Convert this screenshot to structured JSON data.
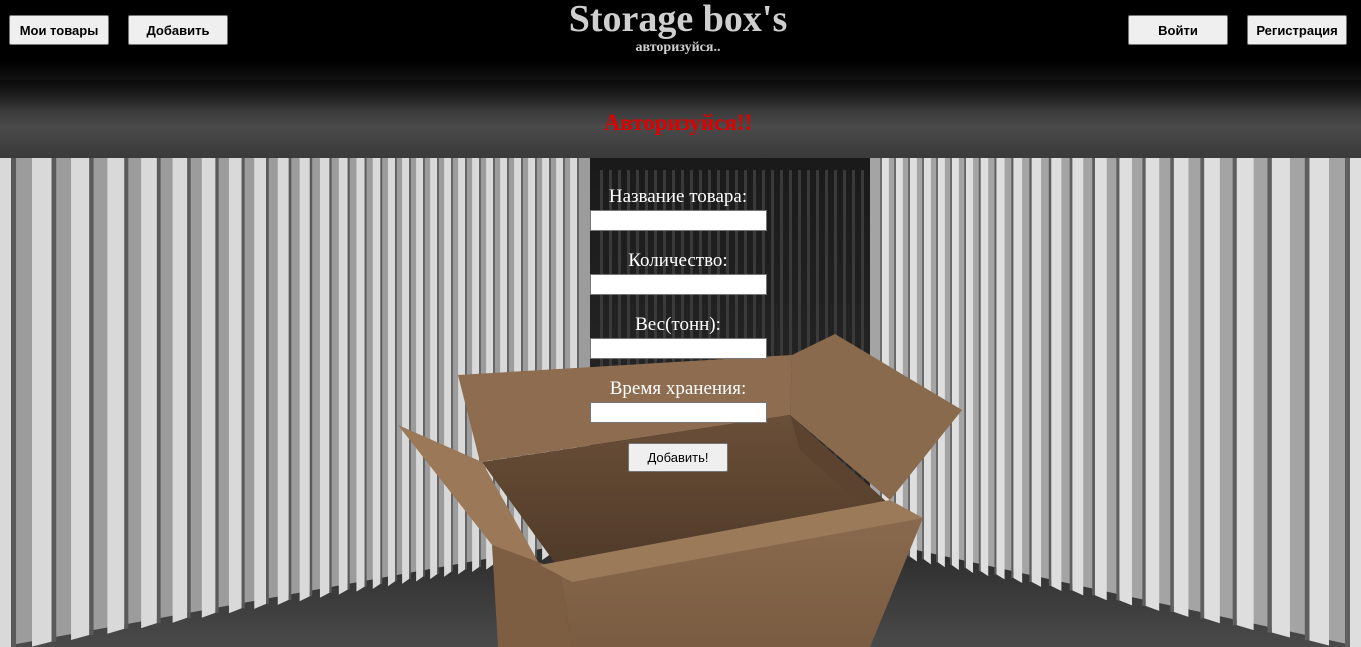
{
  "header": {
    "my_goods_label": "Мои товары",
    "add_label": "Добавить",
    "login_label": "Войти",
    "register_label": "Регистрация",
    "title": "Storage box's",
    "subtitle": "авторизуйся.."
  },
  "main": {
    "warning": "Авторизуйся!!",
    "warning_color": "#e00000",
    "form": {
      "fields": [
        {
          "label": "Название товара:",
          "value": ""
        },
        {
          "label": "Количество:",
          "value": ""
        },
        {
          "label": "Вес(тонн):",
          "value": ""
        },
        {
          "label": "Время хранения:",
          "value": ""
        }
      ],
      "submit_label": "Добавить!"
    }
  },
  "background": {
    "scene": "shipping-container-interior-with-cardboard-box",
    "wall_color": "#cfcfcf",
    "box_color": "#8a6a4e"
  }
}
